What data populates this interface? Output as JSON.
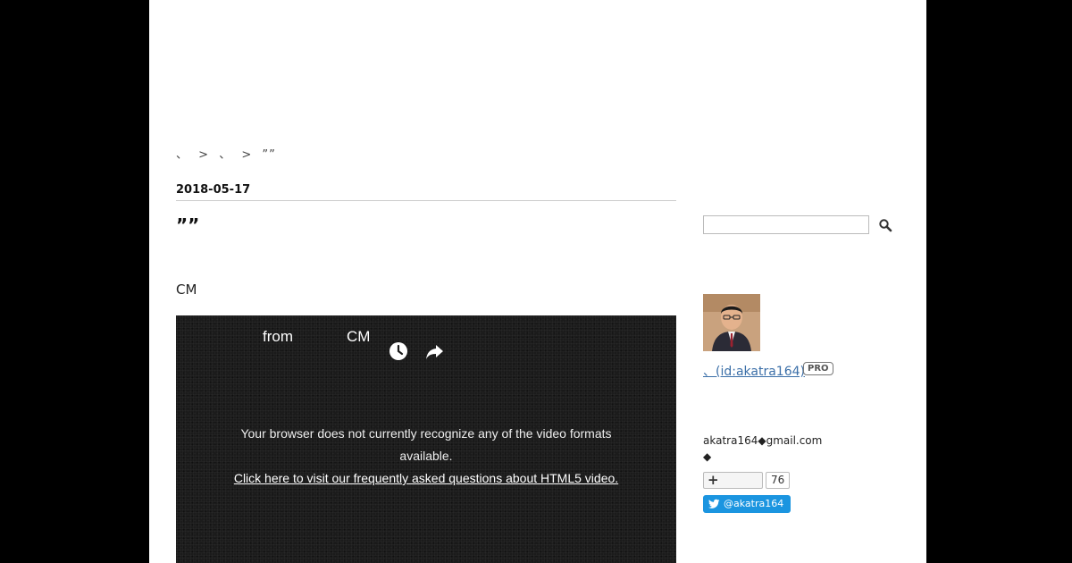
{
  "breadcrumb": {
    "item1": "、",
    "sep1": ">",
    "item2": "、",
    "sep2": ">",
    "item3": "””"
  },
  "entry": {
    "date": "2018-05-17",
    "title": "””",
    "text": "CM"
  },
  "video": {
    "from_label": "from",
    "channel_label": "CM",
    "clock_icon": "clock-icon",
    "share_icon": "share-icon",
    "message": "Your browser does not currently recognize any of the video formats available.",
    "faq_link": "Click here to visit our frequently asked questions about HTML5 video."
  },
  "sidebar": {
    "search_placeholder": "",
    "search_icon": "search-icon",
    "profile_id": "、(id:akatra164)",
    "pro_badge": "PRO",
    "email": "akatra164◆gmail.com",
    "diamond": "◆",
    "subscribe_icon": "plus-icon",
    "subscriber_count": "76",
    "twitter_label": "@akatra164"
  },
  "colors": {
    "background": "#000000",
    "page": "#ffffff",
    "link": "#3b6fa8",
    "twitter": "#1b95e0"
  }
}
